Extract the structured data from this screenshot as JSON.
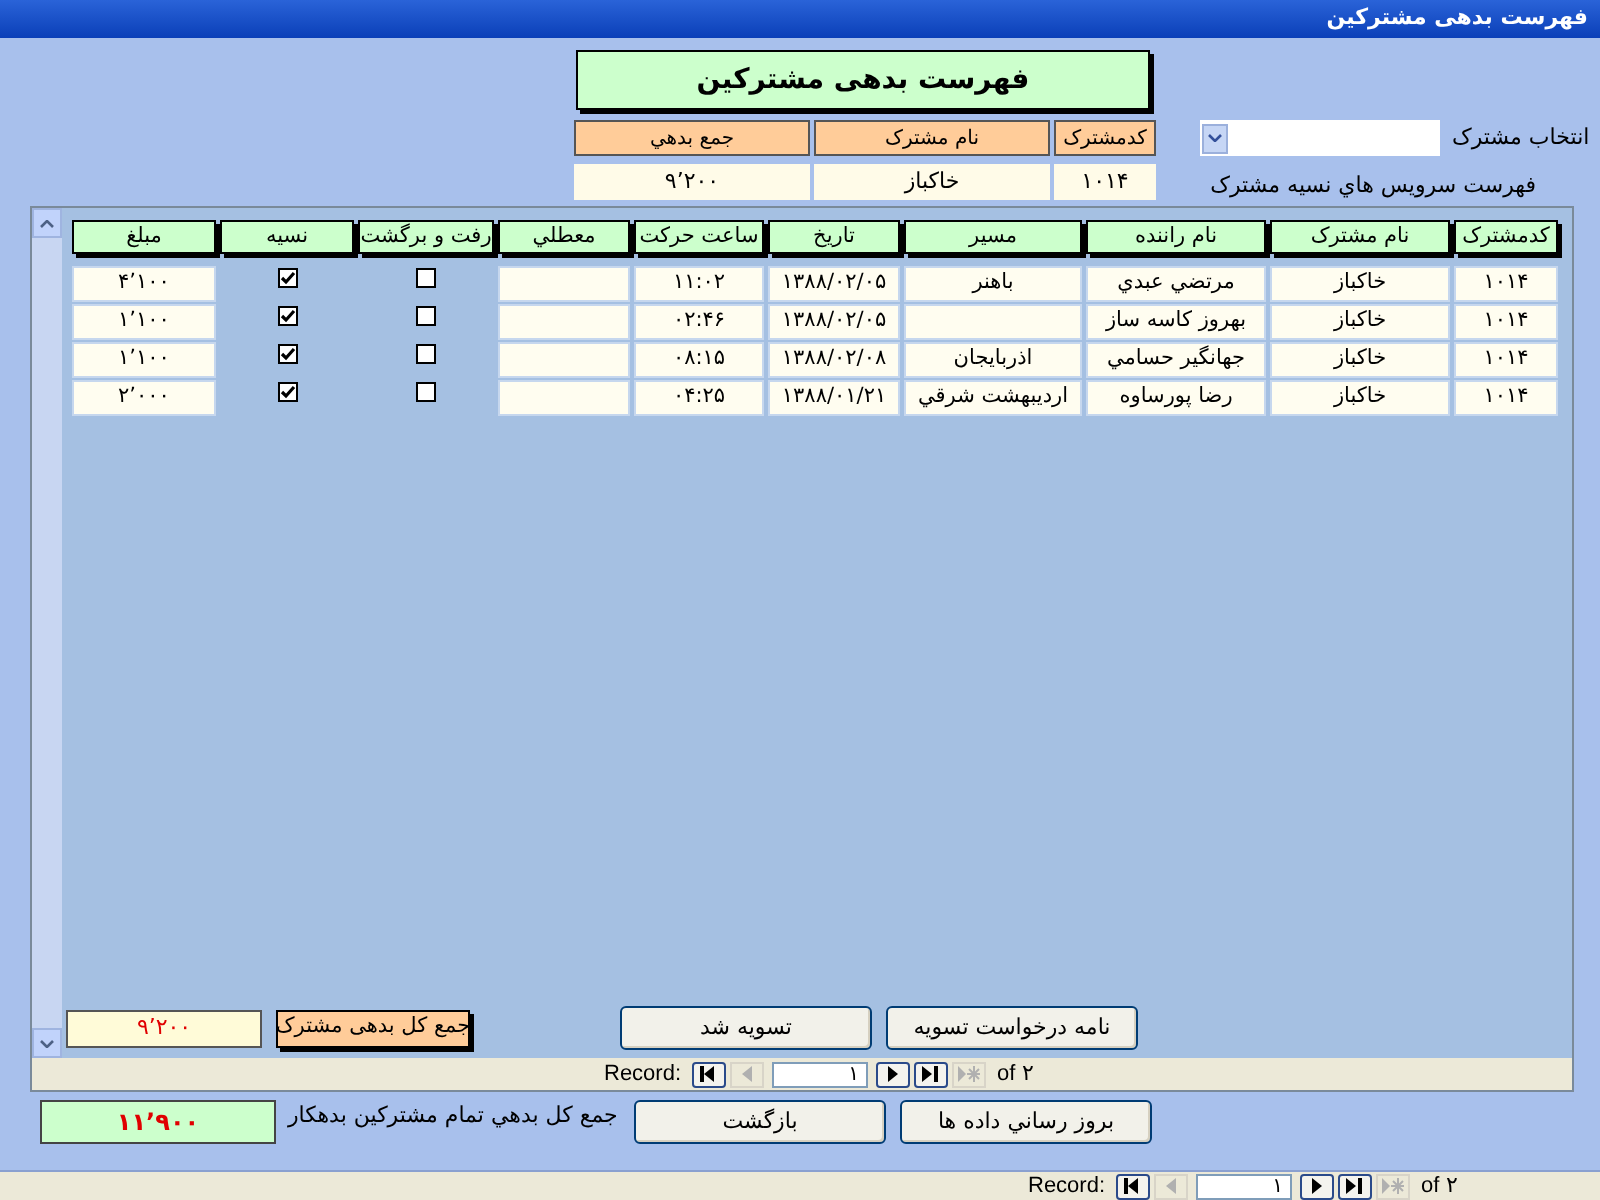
{
  "window": {
    "title": "فهرست بدهی مشترکین"
  },
  "header": {
    "title": "فهرست بدهی مشترکین",
    "columns": [
      "کدمشترک",
      "نام مشترک",
      "جمع بدهي"
    ],
    "values": [
      "۱۰۱۴",
      "خاکباز",
      "۹٬۲۰۰"
    ]
  },
  "customer_select": {
    "label": "انتخاب مشترک"
  },
  "list_label": "فهرست سرويس هاي نسيه مشترک",
  "table": {
    "columns": [
      {
        "label": "کدمشترک",
        "kind": "text"
      },
      {
        "label": "نام مشترک",
        "kind": "text"
      },
      {
        "label": "نام راننده",
        "kind": "text"
      },
      {
        "label": "مسير",
        "kind": "text"
      },
      {
        "label": "تاريخ",
        "kind": "text"
      },
      {
        "label": "ساعت حرکت",
        "kind": "text"
      },
      {
        "label": "معطلي",
        "kind": "text"
      },
      {
        "label": "رفت و برگشت",
        "kind": "check"
      },
      {
        "label": "نسيه",
        "kind": "check"
      },
      {
        "label": "مبلغ",
        "kind": "text"
      }
    ],
    "rows": [
      {
        "cells": [
          "۱۰۱۴",
          "خاکباز",
          "مرتضي عبدي",
          "باهنر",
          "۱۳۸۸/۰۲/۰۵",
          "۱۱:۰۲",
          "",
          false,
          true,
          "۴٬۱۰۰"
        ]
      },
      {
        "cells": [
          "۱۰۱۴",
          "خاکباز",
          "بهروز کاسه ساز",
          "",
          "۱۳۸۸/۰۲/۰۵",
          "۰۲:۴۶",
          "",
          false,
          true,
          "۱٬۱۰۰"
        ]
      },
      {
        "cells": [
          "۱۰۱۴",
          "خاکباز",
          "جهانگير حسامي",
          "اذربايجان",
          "۱۳۸۸/۰۲/۰۸",
          "۰۸:۱۵",
          "",
          false,
          true,
          "۱٬۱۰۰"
        ]
      },
      {
        "cells": [
          "۱۰۱۴",
          "خاکباز",
          "رضا پورساوه",
          "ارديبهشت شرقي",
          "۱۳۸۸/۰۱/۲۱",
          "۰۴:۲۵",
          "",
          false,
          true,
          "۲٬۰۰۰"
        ]
      }
    ]
  },
  "subtotal": {
    "label": "جمع کل بدهی مشترک",
    "value": "۹٬۲۰۰"
  },
  "sub_buttons": [
    "نامه درخواست تسويه",
    "تسويه شد"
  ],
  "sub_record_nav": {
    "label": "Record:",
    "value": "۱",
    "of": "of ۲",
    "buttons": [
      {
        "kind": "first",
        "disabled": false
      },
      {
        "kind": "prev",
        "disabled": true
      },
      {
        "kind": "next",
        "disabled": false
      },
      {
        "kind": "last",
        "disabled": false
      },
      {
        "kind": "new",
        "disabled": true
      }
    ]
  },
  "grand_total": {
    "label": "جمع کل بدهي تمام مشترکين بدهکار",
    "value": "۱۱٬۹۰۰"
  },
  "buttons": [
    "بروز رساني داده ها",
    "بازگشت"
  ],
  "record_nav": {
    "label": "Record:",
    "value": "۱",
    "of": "of ۲",
    "buttons": [
      {
        "kind": "first",
        "disabled": false
      },
      {
        "kind": "prev",
        "disabled": true
      },
      {
        "kind": "next",
        "disabled": false
      },
      {
        "kind": "last",
        "disabled": false
      },
      {
        "kind": "new",
        "disabled": true
      }
    ]
  }
}
